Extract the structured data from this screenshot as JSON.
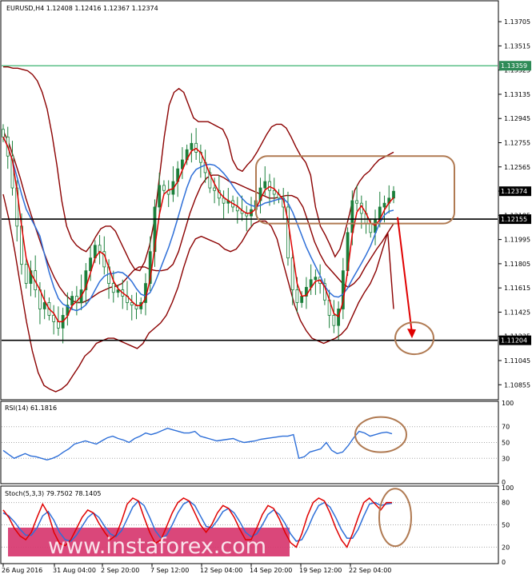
{
  "chart_data": [
    {
      "type": "candlestick",
      "title": "EURUSD,H4  1.12408 1.12416 1.12367 1.12374",
      "ylim": [
        1.1075,
        1.1385
      ],
      "y_ticks": [
        "1.13705",
        "1.13515",
        "1.13325",
        "1.13135",
        "1.12945",
        "1.12755",
        "1.12565",
        "1.12375",
        "1.12185",
        "1.11995",
        "1.11805",
        "1.11615",
        "1.11425",
        "1.11235",
        "1.11045",
        "1.10855"
      ],
      "x_ticks": [
        "26 Aug 2016",
        "31 Aug 04:00",
        "2 Sep 20:00",
        "7 Sep 12:00",
        "12 Sep 04:00",
        "14 Sep 20:00",
        "19 Sep 12:00",
        "22 Sep 04:00"
      ],
      "levels": [
        {
          "name": "resistance",
          "value": 1.13359,
          "label": "1.13359",
          "color": "#3cb371"
        },
        {
          "name": "current",
          "value": 1.12374,
          "label": "1.12374",
          "color": "#000000"
        },
        {
          "name": "support-upper",
          "value": 1.12155,
          "label": "1.12155",
          "color": "#000000"
        },
        {
          "name": "support-lower",
          "value": 1.11204,
          "label": "1.11204",
          "color": "#000000"
        }
      ],
      "series": [
        {
          "name": "close",
          "values": [
            1.128,
            1.1265,
            1.124,
            1.121,
            1.118,
            1.1165,
            1.1175,
            1.116,
            1.1145,
            1.115,
            1.114,
            1.1135,
            1.113,
            1.114,
            1.1148,
            1.1155,
            1.115,
            1.116,
            1.1175,
            1.1185,
            1.1195,
            1.119,
            1.1178,
            1.1165,
            1.1158,
            1.116,
            1.1155,
            1.115,
            1.1148,
            1.1145,
            1.115,
            1.1165,
            1.119,
            1.1225,
            1.1242,
            1.1238,
            1.1235,
            1.1245,
            1.1255,
            1.1262,
            1.127,
            1.1275,
            1.1268,
            1.126,
            1.1252,
            1.124,
            1.1238,
            1.1232,
            1.1228,
            1.123,
            1.1225,
            1.1222,
            1.122,
            1.1218,
            1.1223,
            1.123,
            1.124,
            1.1245,
            1.1238,
            1.1235,
            1.1232,
            1.1225,
            1.1185,
            1.116,
            1.115,
            1.1155,
            1.1162,
            1.1168,
            1.117,
            1.1165,
            1.1152,
            1.114,
            1.1132,
            1.1145,
            1.1175,
            1.1205,
            1.123,
            1.1228,
            1.122,
            1.1212,
            1.1205,
            1.1215,
            1.1225,
            1.1228,
            1.1232,
            1.12374
          ]
        },
        {
          "name": "boll-upper",
          "values": [
            1.1335,
            1.1335,
            1.1334,
            1.1334,
            1.1333,
            1.1332,
            1.1329,
            1.1324,
            1.1315,
            1.1302,
            1.1282,
            1.1258,
            1.123,
            1.121,
            1.12,
            1.1195,
            1.1192,
            1.119,
            1.1195,
            1.1202,
            1.1208,
            1.121,
            1.121,
            1.1206,
            1.1198,
            1.119,
            1.1182,
            1.1176,
            1.1175,
            1.1182,
            1.1195,
            1.1215,
            1.1248,
            1.128,
            1.1305,
            1.1315,
            1.1318,
            1.1315,
            1.1305,
            1.1295,
            1.1292,
            1.1292,
            1.1292,
            1.129,
            1.1288,
            1.1286,
            1.1278,
            1.1262,
            1.1255,
            1.1253,
            1.1258,
            1.1262,
            1.1268,
            1.1275,
            1.1282,
            1.1288,
            1.129,
            1.129,
            1.1287,
            1.128,
            1.1272,
            1.1265,
            1.126,
            1.125,
            1.1225,
            1.121,
            1.1203,
            1.1195,
            1.1186,
            1.1192,
            1.1205,
            1.122,
            1.1238,
            1.1245,
            1.125,
            1.1253,
            1.1258,
            1.1262,
            1.1264,
            1.1266,
            1.1268
          ]
        },
        {
          "name": "boll-middle",
          "values": [
            1.1285,
            1.1275,
            1.1262,
            1.1248,
            1.1232,
            1.1218,
            1.1205,
            1.1192,
            1.118,
            1.117,
            1.1162,
            1.1156,
            1.1152,
            1.115,
            1.115,
            1.1152,
            1.1155,
            1.1158,
            1.116,
            1.1162,
            1.1163,
            1.1165,
            1.117,
            1.1175,
            1.1178,
            1.1178,
            1.1176,
            1.1175,
            1.1175,
            1.1176,
            1.118,
            1.119,
            1.1205,
            1.122,
            1.1232,
            1.1242,
            1.1248,
            1.125,
            1.125,
            1.1248,
            1.1245,
            1.1244,
            1.1242,
            1.124,
            1.1238,
            1.1236,
            1.1234,
            1.1232,
            1.1232,
            1.1233,
            1.1234,
            1.1234,
            1.1232,
            1.1225,
            1.1212,
            1.1198,
            1.1188,
            1.118,
            1.1175,
            1.117,
            1.1165,
            1.1162,
            1.1165,
            1.117,
            1.1178,
            1.1185,
            1.1192,
            1.1198,
            1.1205,
            1.1212
          ]
        },
        {
          "name": "boll-lower",
          "values": [
            1.1235,
            1.1215,
            1.119,
            1.1162,
            1.1135,
            1.1112,
            1.1095,
            1.1085,
            1.1082,
            1.108,
            1.1082,
            1.1086,
            1.1093,
            1.11,
            1.1108,
            1.1112,
            1.1118,
            1.112,
            1.1122,
            1.1122,
            1.112,
            1.1118,
            1.1116,
            1.1114,
            1.1118,
            1.1126,
            1.113,
            1.1134,
            1.114,
            1.115,
            1.1162,
            1.1178,
            1.1192,
            1.12,
            1.1202,
            1.12,
            1.1198,
            1.1196,
            1.1192,
            1.119,
            1.1192,
            1.1198,
            1.1206,
            1.1212,
            1.1214,
            1.1214,
            1.121,
            1.12,
            1.1182,
            1.1165,
            1.1148,
            1.1136,
            1.1128,
            1.1122,
            1.112,
            1.1118,
            1.112,
            1.1122,
            1.1125,
            1.113,
            1.114,
            1.115,
            1.1158,
            1.1165,
            1.1175,
            1.119,
            1.1205,
            1.1145
          ]
        }
      ]
    },
    {
      "type": "line",
      "title": "RSI(14) 61.1816",
      "ylim": [
        0,
        100
      ],
      "y_ticks": [
        "100",
        "70",
        "50",
        "30",
        "0"
      ],
      "levels": [
        70,
        50,
        30
      ],
      "series": [
        {
          "name": "RSI(14)",
          "color": "#2e6fd8",
          "values": [
            40,
            35,
            30,
            33,
            36,
            33,
            32,
            30,
            28,
            30,
            33,
            38,
            42,
            48,
            50,
            52,
            50,
            48,
            52,
            56,
            58,
            55,
            53,
            50,
            55,
            58,
            62,
            60,
            62,
            65,
            68,
            66,
            64,
            62,
            62,
            64,
            58,
            56,
            54,
            52,
            53,
            54,
            55,
            52,
            50,
            51,
            52,
            54,
            55,
            56,
            57,
            58,
            58,
            60,
            30,
            32,
            38,
            40,
            42,
            50,
            40,
            36,
            38,
            46,
            56,
            64,
            62,
            58,
            60,
            62,
            63,
            61
          ]
        }
      ]
    },
    {
      "type": "line",
      "title": "Stoch(5,3,3) 79.7502 78.1405",
      "ylim": [
        0,
        100
      ],
      "y_ticks": [
        "100",
        "80",
        "50",
        "20",
        "0"
      ],
      "levels": [
        80,
        50,
        20
      ],
      "series": [
        {
          "name": "main",
          "color": "#e00000",
          "values": [
            70,
            60,
            45,
            35,
            30,
            40,
            60,
            78,
            65,
            40,
            25,
            22,
            30,
            45,
            60,
            70,
            66,
            52,
            40,
            30,
            36,
            55,
            78,
            86,
            82,
            60,
            40,
            25,
            30,
            48,
            66,
            80,
            86,
            82,
            66,
            50,
            40,
            50,
            66,
            76,
            72,
            60,
            44,
            30,
            30,
            46,
            64,
            76,
            72,
            58,
            40,
            26,
            20,
            38,
            62,
            80,
            86,
            82,
            66,
            46,
            30,
            20,
            38,
            60,
            80,
            86,
            78,
            70,
            80,
            80
          ]
        },
        {
          "name": "signal",
          "color": "#2e6fd8",
          "values": [
            66,
            62,
            54,
            44,
            36,
            36,
            46,
            62,
            68,
            56,
            40,
            30,
            28,
            36,
            48,
            60,
            66,
            60,
            48,
            38,
            34,
            42,
            58,
            74,
            82,
            76,
            60,
            42,
            32,
            36,
            50,
            66,
            78,
            82,
            76,
            62,
            48,
            46,
            56,
            68,
            72,
            66,
            54,
            40,
            34,
            38,
            50,
            64,
            70,
            64,
            52,
            38,
            28,
            30,
            44,
            62,
            76,
            80,
            74,
            60,
            44,
            32,
            32,
            44,
            62,
            78,
            80,
            76,
            78,
            79
          ]
        }
      ]
    }
  ],
  "watermark": "www.instaforex.com",
  "colors": {
    "annotation": "#b07a52",
    "arrow": "#e00000",
    "boll": "#8b0000",
    "ma_red": "#e00000",
    "ma_blue": "#2e6fd8",
    "tag_bg": "#2e8b57",
    "watermark_bg": "#d6336c"
  }
}
